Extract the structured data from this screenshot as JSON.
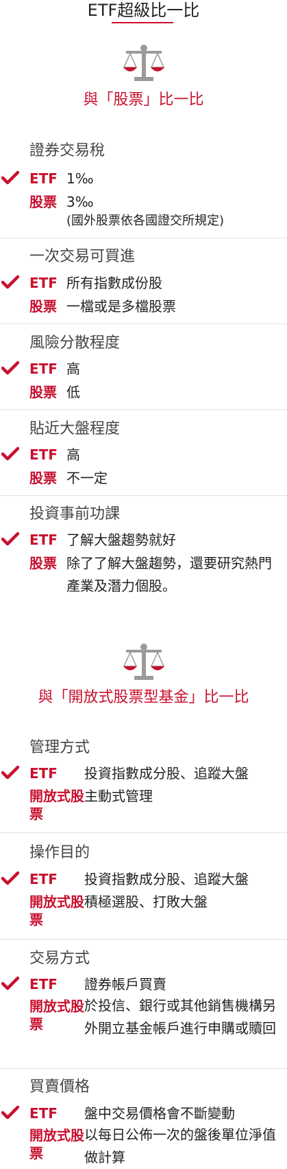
{
  "page_title": "ETF超級比一比",
  "section1": {
    "title": "與「股票」比一比",
    "blocks": [
      {
        "title": "證券交易稅",
        "etf_label": "ETF",
        "etf_value": "1‰",
        "stock_label": "股票",
        "stock_value": "3‰",
        "stock_note": "(國外股票依各國證交所規定)"
      },
      {
        "title": "一次交易可買進",
        "etf_label": "ETF",
        "etf_value": "所有指數成份股",
        "stock_label": "股票",
        "stock_value": "一檔或是多檔股票"
      },
      {
        "title": "風險分散程度",
        "etf_label": "ETF",
        "etf_value": "高",
        "stock_label": "股票",
        "stock_value": "低"
      },
      {
        "title": "貼近大盤程度",
        "etf_label": "ETF",
        "etf_value": "高",
        "stock_label": "股票",
        "stock_value": "不一定"
      },
      {
        "title": "投資事前功課",
        "etf_label": "ETF",
        "etf_value": "了解大盤趨勢就好",
        "stock_label": "股票",
        "stock_value": "除了了解大盤趨勢，還要研究熱門產業及潛力個股。"
      }
    ]
  },
  "section2": {
    "title": "與「開放式股票型基金」比一比",
    "blocks": [
      {
        "title": "管理方式",
        "etf_label": "ETF",
        "etf_value": "投資指數成分股、追蹤大盤",
        "fund_label": "開放式股票",
        "fund_value": "主動式管理"
      },
      {
        "title": "操作目的",
        "etf_label": "ETF",
        "etf_value": "投資指數成分股、追蹤大盤",
        "fund_label": "開放式股票",
        "fund_value": "積極選股、打敗大盤"
      },
      {
        "title": "交易方式",
        "etf_label": "ETF",
        "etf_value": "證券帳戶買賣",
        "fund_label": "開放式股票",
        "fund_value": "於投信、銀行或其他銷售機構另外開立基金帳戶進行申購或贖回"
      },
      {
        "title": "買賣價格",
        "etf_label": "ETF",
        "etf_value": "盤中交易價格會不斷變動",
        "fund_label": "開放式股票",
        "fund_value": "以每日公佈一次的盤後單位淨值做計算"
      }
    ]
  },
  "colors": {
    "accent": "#c8102e",
    "icon_gray": "#9a9a9a",
    "divider": "#e0e0e0"
  }
}
